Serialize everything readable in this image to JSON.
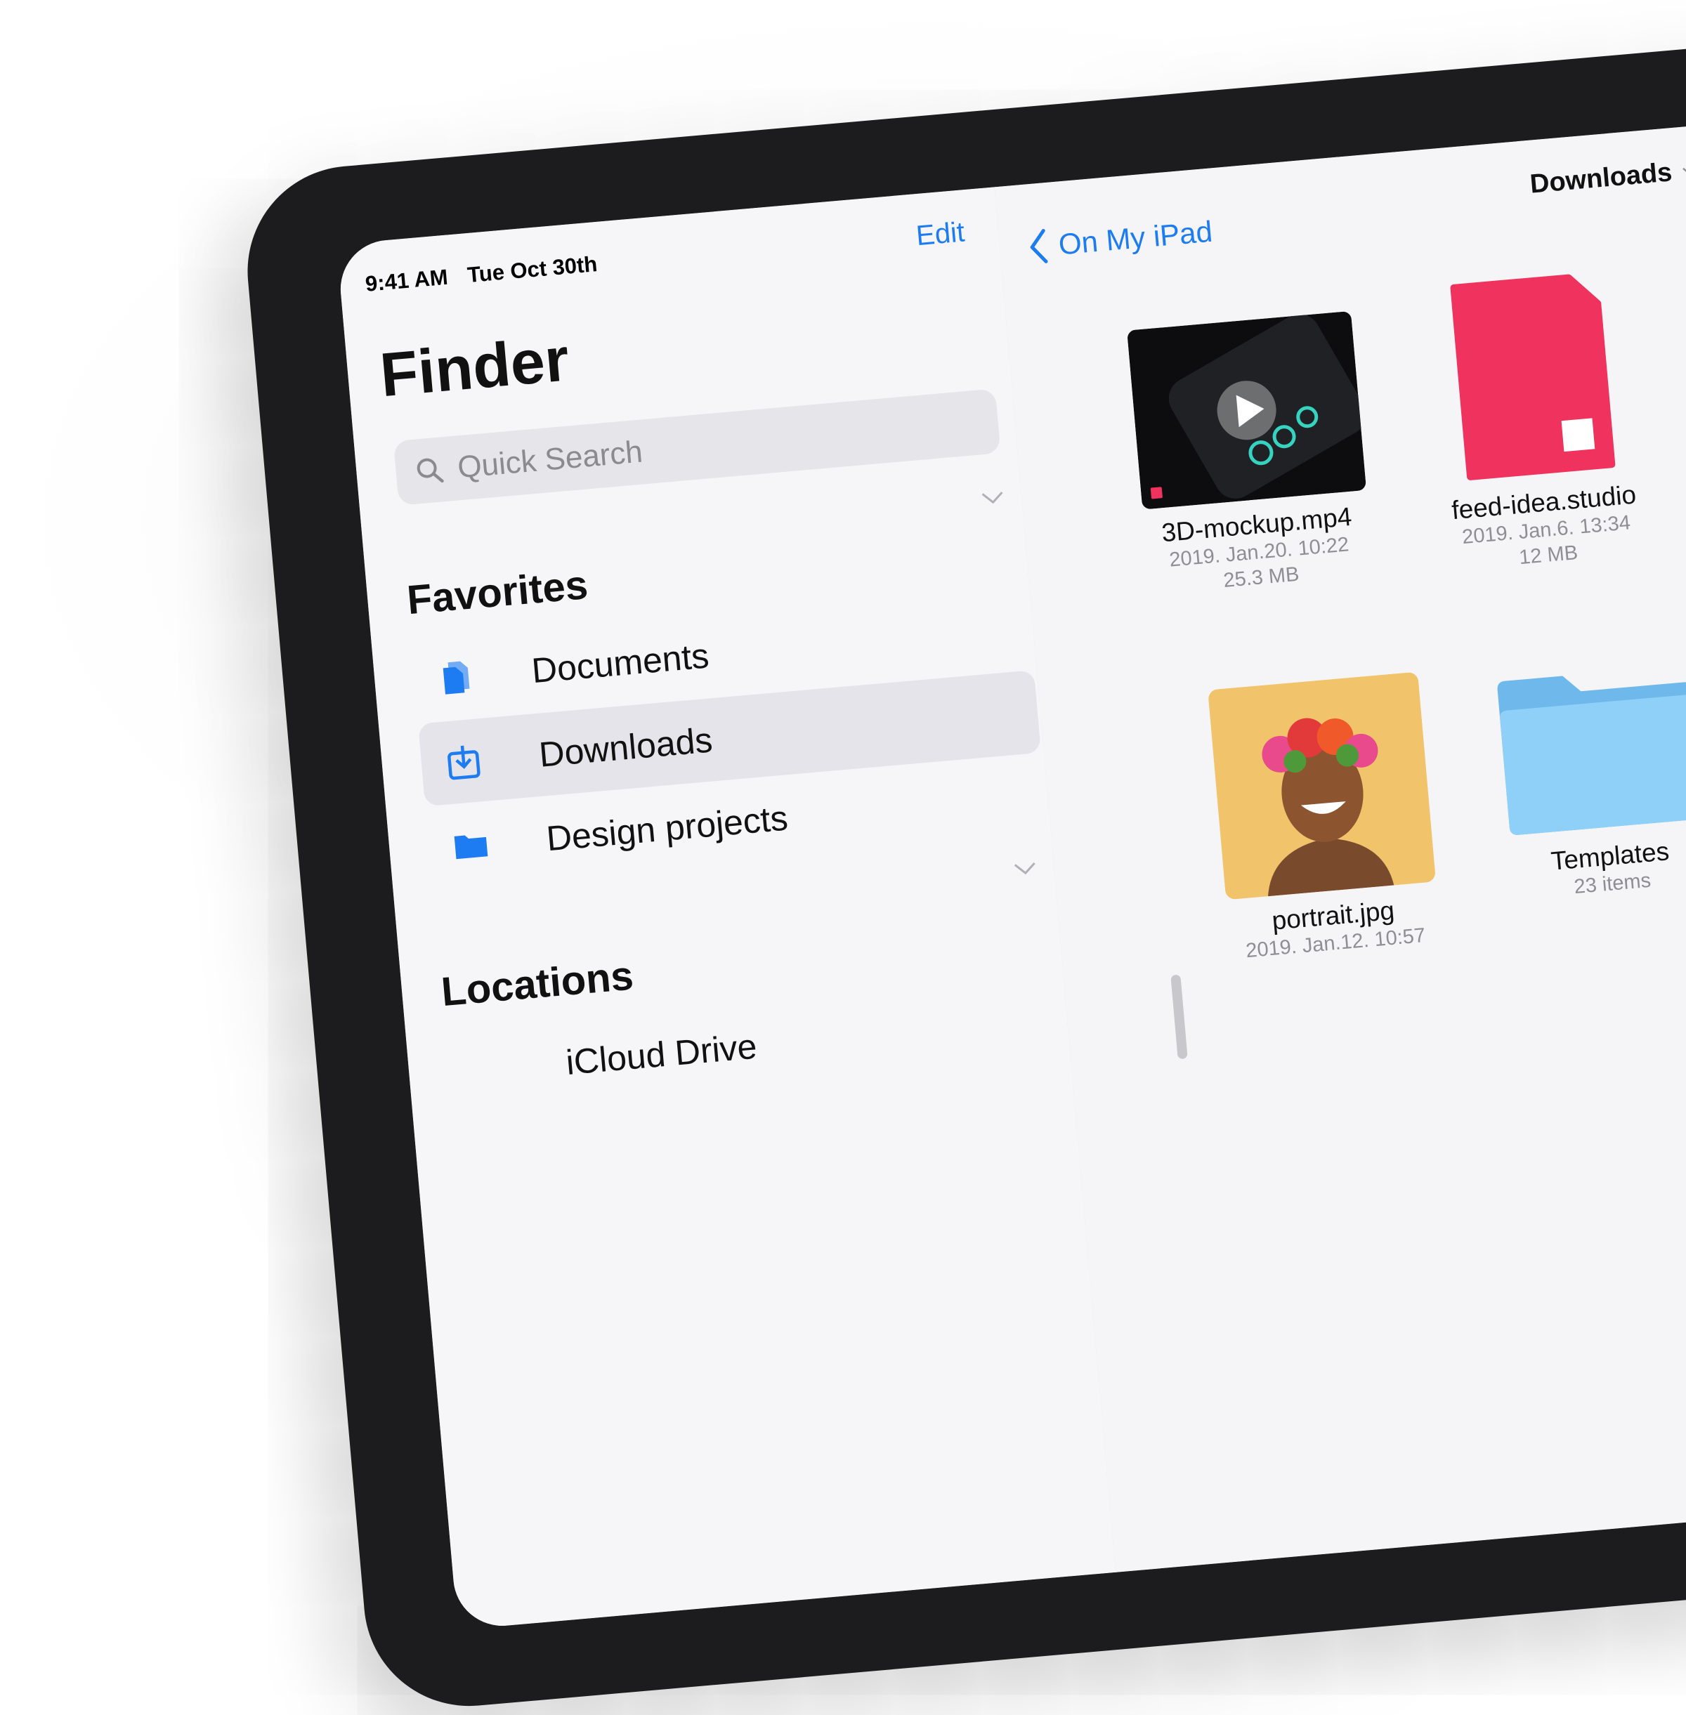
{
  "status_bar": {
    "time": "9:41 AM",
    "date": "Tue Oct 30th"
  },
  "sidebar": {
    "edit_label": "Edit",
    "title": "Finder",
    "search_placeholder": "Quick Search",
    "favorites_title": "Favorites",
    "favorites": [
      {
        "label": "Documents",
        "icon": "documents-icon"
      },
      {
        "label": "Downloads",
        "icon": "download-icon",
        "selected": true
      },
      {
        "label": "Design projects",
        "icon": "folder-icon"
      }
    ],
    "locations_title": "Locations",
    "locations": [
      {
        "label": "iCloud Drive"
      }
    ]
  },
  "content": {
    "back_label": "On My iPad",
    "title": "Downloads",
    "files": [
      {
        "name": "3D-mockup.mp4",
        "date": "2019. Jan.20. 10:22",
        "size": "25.3 MB",
        "kind": "video"
      },
      {
        "name": "feed-idea.studio",
        "date": "2019. Jan.6. 13:34",
        "size": "12 MB",
        "kind": "document"
      },
      {
        "name": "portrait.jpg",
        "date": "2019. Jan.12. 10:57",
        "kind": "image"
      },
      {
        "name": "Templates",
        "count": "23 items",
        "kind": "folder"
      }
    ]
  },
  "colors": {
    "accent": "#1d7cf2",
    "document_pink": "#f0325f",
    "folder_blue": "#7cc4f2",
    "device_frame": "#1c1c1e"
  }
}
